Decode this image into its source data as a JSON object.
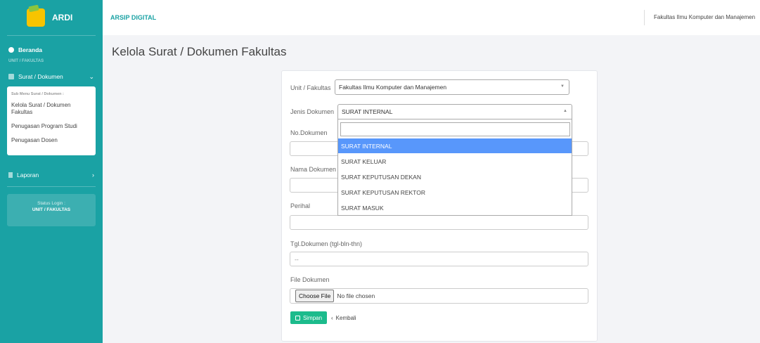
{
  "sidebar": {
    "brand": "ARDI",
    "dashboard": "Beranda",
    "section": "UNIT / FAKULTAS",
    "surat_menu": "Surat / Dokumen",
    "submenu_title": "Sub Menu Surat / Dokumen :",
    "submenu_items": [
      "Kelola Surat / Dokumen Fakultas",
      "Penugasan Program Studi",
      "Penugasan Dosen"
    ],
    "laporan": "Laporan",
    "status_label": "Status Login :",
    "status_value": "UNIT / FAKULTAS"
  },
  "topbar": {
    "title": "ARSIP DIGITAL",
    "user": "Fakultas Ilmu Komputer dan Manajemen"
  },
  "page": {
    "title": "Kelola Surat / Dokumen Fakultas"
  },
  "form": {
    "unit_label": "Unit / Fakultas",
    "unit_value": "Fakultas Ilmu Komputer dan Manajemen",
    "jenis_label": "Jenis Dokumen",
    "jenis_value": "SURAT INTERNAL",
    "jenis_options": [
      "SURAT INTERNAL",
      "SURAT KELUAR",
      "SURAT KEPUTUSAN DEKAN",
      "SURAT KEPUTUSAN REKTOR",
      "SURAT MASUK"
    ],
    "no_label": "No.Dokumen",
    "nama_label": "Nama Dokumen",
    "perihal_label": "Perihal",
    "tgl_label": "Tgl.Dokumen (tgl-bln-thn)",
    "tgl_value": "--",
    "file_label": "File Dokumen",
    "file_button": "Choose File",
    "file_status": "No file chosen",
    "save_button": "Simpan",
    "back_button": "Kembali"
  }
}
